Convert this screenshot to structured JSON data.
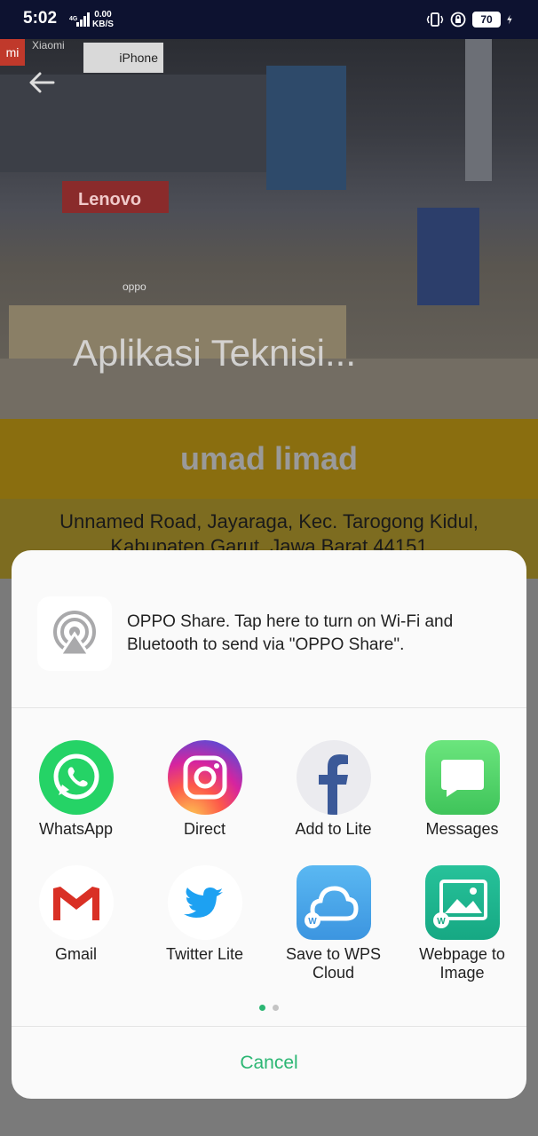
{
  "status_bar": {
    "time": "5:02",
    "network_type": "4G",
    "speed_value": "0.00",
    "speed_unit": "KB/S",
    "battery": "70"
  },
  "hero": {
    "title": "Aplikasi Teknisi...",
    "sign_iphone": "iPhone",
    "sign_mi": "mi",
    "sign_xiaomi": "Xiaomi",
    "sign_lenovo": "Lenovo",
    "sign_oppo": "oppo"
  },
  "profile": {
    "name": "umad limad",
    "address": "Unnamed Road, Jayaraga, Kec. Tarogong Kidul, Kabupaten Garut, Jawa Barat 44151"
  },
  "share_sheet": {
    "oppo_share_text": "OPPO Share. Tap here to turn on Wi-Fi and Bluetooth to send via \"OPPO Share\".",
    "apps": [
      {
        "label": "WhatsApp",
        "icon": "whatsapp-icon"
      },
      {
        "label": "Direct",
        "icon": "instagram-icon"
      },
      {
        "label": "Add to Lite",
        "icon": "facebook-lite-icon"
      },
      {
        "label": "Messages",
        "icon": "messages-icon"
      },
      {
        "label": "Gmail",
        "icon": "gmail-icon"
      },
      {
        "label": "Twitter Lite",
        "icon": "twitter-icon"
      },
      {
        "label": "Save to WPS Cloud",
        "icon": "wps-cloud-icon"
      },
      {
        "label": "Webpage to Image",
        "icon": "webpage-to-image-icon"
      }
    ],
    "page_indicator": {
      "pages": 2,
      "current": 1
    },
    "cancel_label": "Cancel"
  },
  "colors": {
    "accent": "#2bb673",
    "whatsapp": "#25d366",
    "messages": "#4cd964",
    "wps": "#4aa8ec",
    "webpage_to_image": "#1fb58f"
  }
}
